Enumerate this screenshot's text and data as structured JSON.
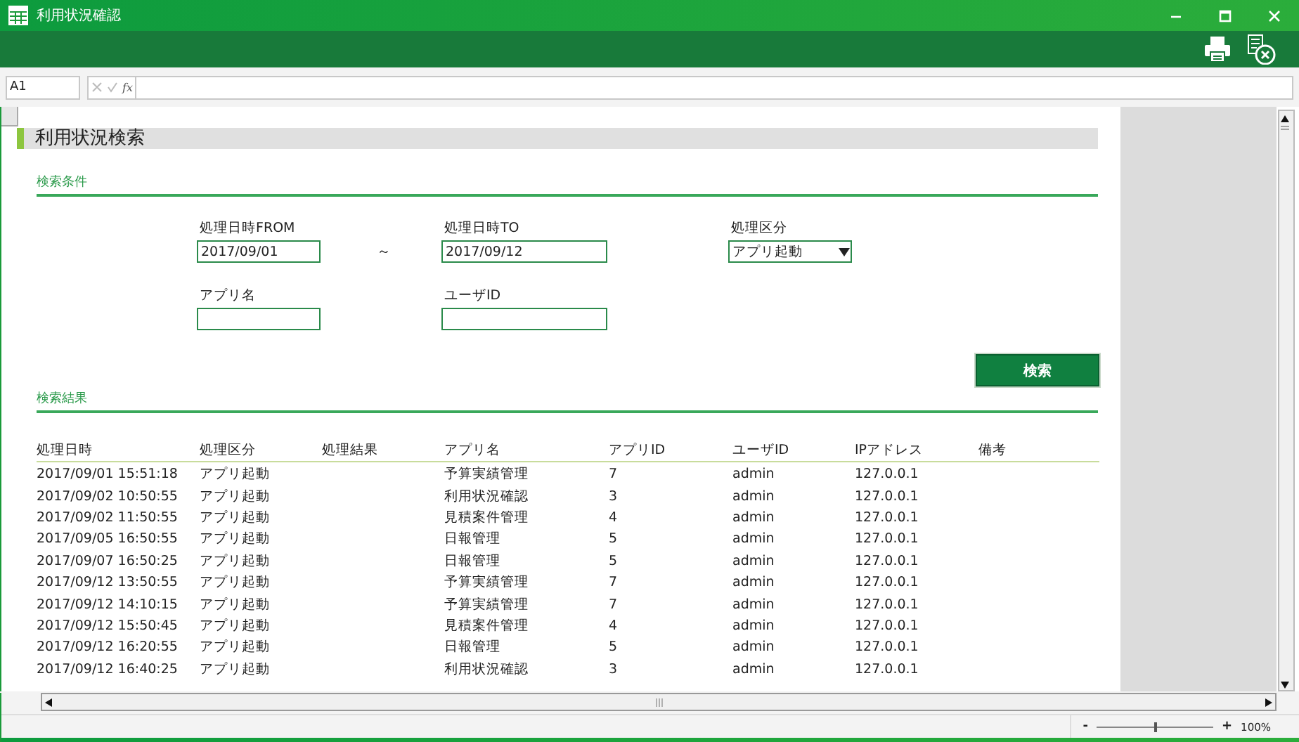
{
  "window": {
    "title": "利用状況確認"
  },
  "formula_bar": {
    "cell_ref": "A1",
    "function_label": "fx"
  },
  "sheet": {
    "heading": "利用状況検索",
    "conditions_title": "検索条件",
    "range_separator": "～",
    "fields": [
      {
        "label": "処理日時FROM",
        "kind": "text",
        "value": "2017/09/01"
      },
      {
        "label": "処理日時TO",
        "kind": "text",
        "value": "2017/09/12"
      },
      {
        "label": "処理区分",
        "kind": "select",
        "value": "アプリ起動"
      },
      {
        "label": "アプリ名",
        "kind": "text"
      },
      {
        "label": "ユーザID",
        "kind": "text"
      }
    ],
    "search_button": "検索",
    "results_title": "検索結果"
  },
  "table": {
    "columns": [
      "処理日時",
      "処理区分",
      "処理結果",
      "アプリ名",
      "アプリID",
      "ユーザID",
      "IPアドレス",
      "備考"
    ],
    "rows": [
      {
        "datetime": "2017/09/01 15:51:18",
        "type": "アプリ起動",
        "app_name": "予算実績管理",
        "app_id": "7",
        "user_id": "admin",
        "ip": "127.0.0.1"
      },
      {
        "datetime": "2017/09/02 10:50:55",
        "type": "アプリ起動",
        "app_name": "利用状況確認",
        "app_id": "3",
        "user_id": "admin",
        "ip": "127.0.0.1"
      },
      {
        "datetime": "2017/09/02 11:50:55",
        "type": "アプリ起動",
        "app_name": "見積案件管理",
        "app_id": "4",
        "user_id": "admin",
        "ip": "127.0.0.1"
      },
      {
        "datetime": "2017/09/05 16:50:55",
        "type": "アプリ起動",
        "app_name": "日報管理",
        "app_id": "5",
        "user_id": "admin",
        "ip": "127.0.0.1"
      },
      {
        "datetime": "2017/09/07 16:50:25",
        "type": "アプリ起動",
        "app_name": "日報管理",
        "app_id": "5",
        "user_id": "admin",
        "ip": "127.0.0.1"
      },
      {
        "datetime": "2017/09/12 13:50:55",
        "type": "アプリ起動",
        "app_name": "予算実績管理",
        "app_id": "7",
        "user_id": "admin",
        "ip": "127.0.0.1"
      },
      {
        "datetime": "2017/09/12 14:10:15",
        "type": "アプリ起動",
        "app_name": "予算実績管理",
        "app_id": "7",
        "user_id": "admin",
        "ip": "127.0.0.1"
      },
      {
        "datetime": "2017/09/12 15:50:45",
        "type": "アプリ起動",
        "app_name": "見積案件管理",
        "app_id": "4",
        "user_id": "admin",
        "ip": "127.0.0.1"
      },
      {
        "datetime": "2017/09/12 16:20:55",
        "type": "アプリ起動",
        "app_name": "日報管理",
        "app_id": "5",
        "user_id": "admin",
        "ip": "127.0.0.1"
      },
      {
        "datetime": "2017/09/12 16:40:25",
        "type": "アプリ起動",
        "app_name": "利用状況確認",
        "app_id": "3",
        "user_id": "admin",
        "ip": "127.0.0.1"
      }
    ]
  },
  "status_bar": {
    "zoom_out": "-",
    "zoom_in": "+",
    "zoom": "100%",
    "level": 0.5
  }
}
